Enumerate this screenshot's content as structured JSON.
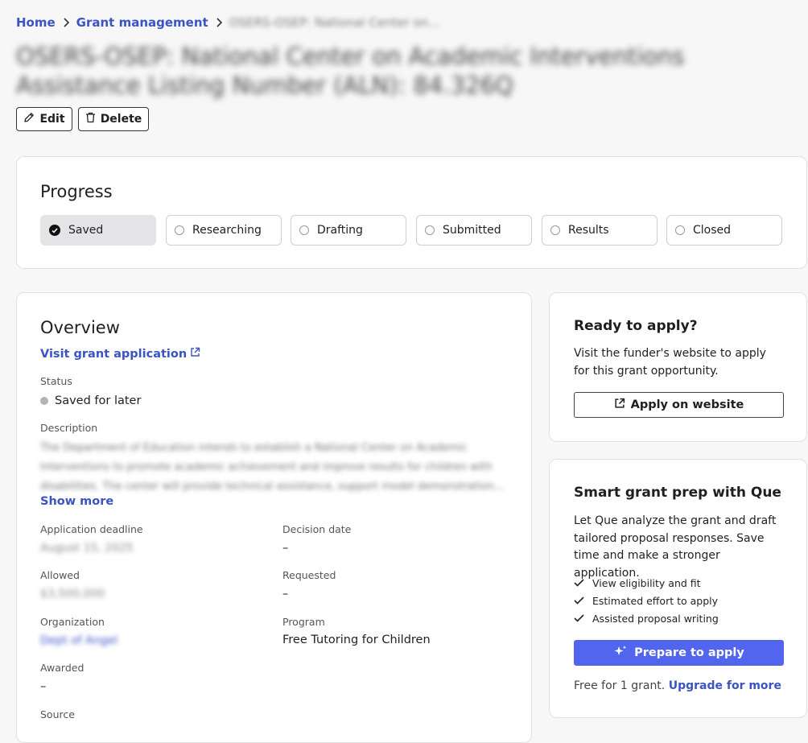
{
  "breadcrumb": {
    "items": [
      "Home",
      "Grant management"
    ],
    "current": "OSERS-OSEP: National Center on..."
  },
  "page": {
    "title": "OSERS-OSEP: National Center on Academic Interventions Assistance Listing Number (ALN): 84.326Q"
  },
  "actions": {
    "edit_label": "Edit",
    "delete_label": "Delete"
  },
  "progress": {
    "title": "Progress",
    "steps": [
      "Saved",
      "Researching",
      "Drafting",
      "Submitted",
      "Results",
      "Closed"
    ],
    "active_step": "Saved"
  },
  "overview": {
    "title": "Overview",
    "visit_link": "Visit grant application",
    "status_label": "Status",
    "status_value": "Saved for later",
    "status_color": "#b4b4b8",
    "description_label": "Description",
    "description_text": "The Department of Education intends to establish a National Center on Academic Interventions to promote academic achievement and improve results for children with disabilities. The center will provide technical assistance, support model demonstration...",
    "show_more": "Show more",
    "fields": {
      "deadline_label": "Application deadline",
      "deadline_value": "August 15, 2025",
      "decision_label": "Decision date",
      "decision_value": "–",
      "allowed_label": "Allowed",
      "allowed_value": "$3,500,000",
      "requested_label": "Requested",
      "requested_value": "–",
      "organization_label": "Organization",
      "organization_value": "Dept of Angel",
      "program_label": "Program",
      "program_value": "Free Tutoring for Children",
      "awarded_label": "Awarded",
      "awarded_value": "–",
      "source_label": "Source"
    }
  },
  "apply_card": {
    "title": "Ready to apply?",
    "text": "Visit the funder's website to apply for this grant opportunity.",
    "button": "Apply on website"
  },
  "que_card": {
    "title": "Smart grant prep with Que",
    "text": "Let Que analyze the grant and draft tailored proposal responses. Save time and make a stronger application.",
    "checks": [
      "View eligibility and fit",
      "Estimated effort to apply",
      "Assisted proposal writing"
    ],
    "button": "Prepare to apply",
    "footer_prefix": "Free for 1 grant. ",
    "footer_link": "Upgrade for more"
  },
  "colors": {
    "accent": "#5165ef",
    "link": "#3b54c4"
  }
}
